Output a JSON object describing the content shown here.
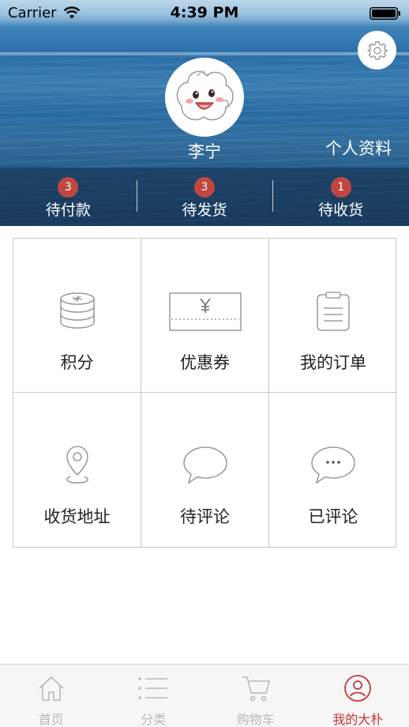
{
  "status_bar": {
    "carrier": "Carrier",
    "time": "4:39 PM",
    "wifi_icon": "wifi-icon",
    "battery_icon": "battery-icon"
  },
  "header": {
    "settings_icon": "gear-icon",
    "avatar_icon": "cartoon-avatar",
    "user_name": "李宁",
    "profile_link": "个人资料"
  },
  "order_status": [
    {
      "count": "3",
      "label": "待付款"
    },
    {
      "count": "3",
      "label": "待发货"
    },
    {
      "count": "1",
      "label": "待收货"
    }
  ],
  "menu_grid": [
    {
      "label": "积分",
      "icon": "coins-icon"
    },
    {
      "label": "优惠券",
      "icon": "coupon-icon"
    },
    {
      "label": "我的订单",
      "icon": "clipboard-icon"
    },
    {
      "label": "收货地址",
      "icon": "location-pin-icon"
    },
    {
      "label": "待评论",
      "icon": "speech-bubble-icon"
    },
    {
      "label": "已评论",
      "icon": "speech-bubble-dots-icon"
    }
  ],
  "tab_bar": {
    "active_index": 3,
    "tabs": [
      {
        "label": "首页",
        "icon": "home-icon"
      },
      {
        "label": "分类",
        "icon": "list-icon"
      },
      {
        "label": "购物车",
        "icon": "cart-icon"
      },
      {
        "label": "我的大朴",
        "icon": "user-icon"
      }
    ]
  },
  "colors": {
    "accent": "#c8363a",
    "badge": "#c0473f",
    "tab_inactive": "#b9b9b9",
    "grid_border": "#c8c8c8"
  }
}
